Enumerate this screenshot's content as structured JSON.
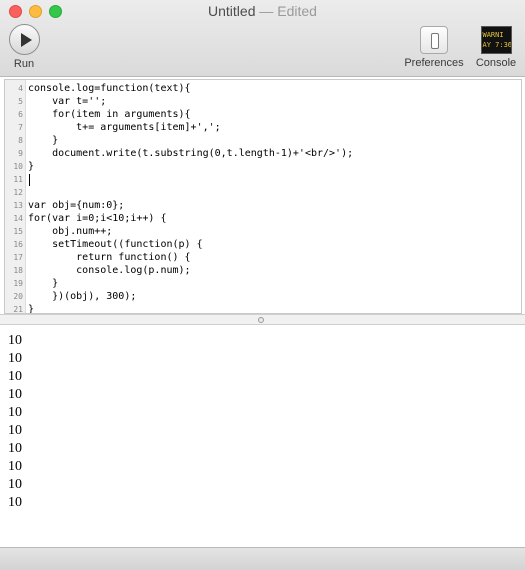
{
  "window": {
    "title": "Untitled",
    "separator": "—",
    "status": "Edited"
  },
  "toolbar": {
    "run_label": "Run",
    "preferences_label": "Preferences",
    "console_label": "Console",
    "console_icon_line1": "WARNI",
    "console_icon_line2": "AY 7:36"
  },
  "editor": {
    "lines": [
      {
        "num": "4",
        "text": "console.log=function(text){"
      },
      {
        "num": "5",
        "text": "    var t='';"
      },
      {
        "num": "6",
        "text": "    for(item in arguments){"
      },
      {
        "num": "7",
        "text": "        t+= arguments[item]+',';"
      },
      {
        "num": "8",
        "text": "    }"
      },
      {
        "num": "9",
        "text": "    document.write(t.substring(0,t.length-1)+'<br/>');"
      },
      {
        "num": "10",
        "text": "}"
      },
      {
        "num": "11",
        "text": ""
      },
      {
        "num": "12",
        "text": ""
      },
      {
        "num": "13",
        "text": "var obj={num:0};"
      },
      {
        "num": "14",
        "text": "for(var i=0;i<10;i++) {"
      },
      {
        "num": "15",
        "text": "    obj.num++;"
      },
      {
        "num": "16",
        "text": "    setTimeout((function(p) {"
      },
      {
        "num": "17",
        "text": "        return function() {"
      },
      {
        "num": "18",
        "text": "        console.log(p.num);"
      },
      {
        "num": "19",
        "text": "    }"
      },
      {
        "num": "20",
        "text": "    })(obj), 300);"
      },
      {
        "num": "21",
        "text": "}"
      }
    ]
  },
  "output": {
    "lines": [
      "10",
      "10",
      "10",
      "10",
      "10",
      "10",
      "10",
      "10",
      "10",
      "10"
    ]
  }
}
